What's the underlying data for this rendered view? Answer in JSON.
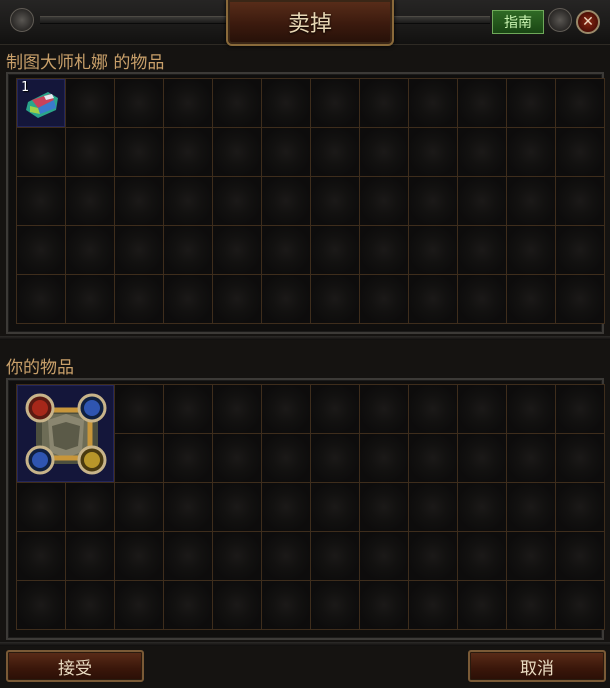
{
  "window": {
    "title": "卖掉",
    "guide_label": "指南",
    "close_icon": "close-icon"
  },
  "npc_section": {
    "label": "制图大师札娜 的物品",
    "rows": 5,
    "cols": 12,
    "items": [
      {
        "name": "map-fragment-item",
        "icon": "map-icon",
        "quantity": "1"
      }
    ]
  },
  "player_section": {
    "label": "你的物品",
    "rows": 5,
    "cols": 12,
    "items": [
      {
        "name": "socketed-armor-item",
        "icon": "armor-icon",
        "sockets": [
          "red",
          "blue",
          "blue",
          "yellow"
        ]
      }
    ]
  },
  "buttons": {
    "accept_label": "接受",
    "cancel_label": "取消"
  },
  "colors": {
    "label_text": "#c9a06a",
    "guide_green": "#2f6a25",
    "button_red": "#3a160a"
  }
}
